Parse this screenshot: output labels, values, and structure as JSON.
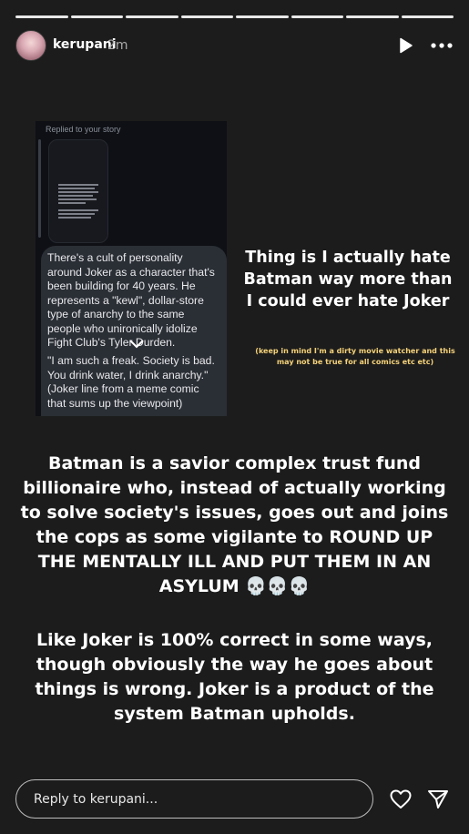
{
  "story": {
    "segments_total": 8,
    "current_segment": 8,
    "username": "kerupani",
    "time_ago": "2m"
  },
  "icons": {
    "avatar": "avatar-photo",
    "play": "play-icon",
    "more": "more-icon",
    "chevron": "chevron-down-icon",
    "heart": "heart-icon",
    "send": "send-icon",
    "skull": "skull-emoji"
  },
  "screenshot": {
    "replied_label": "Replied to your story",
    "message_part1": "There's a cult of personality around Joker as a character that's been building for 40 years. He represents a \"kewl\", dollar-store type of anarchy to the same people who unironically idolize Fight Club's Tyler Durden.",
    "message_part2": "\"I am such a freak. Society is bad. You drink water, I drink anarchy.\" (Joker line from a meme comic that sums up the viewpoint)"
  },
  "text": {
    "heading": "Thing is I actually hate Batman way more than I could ever hate Joker",
    "note": "(keep in mind I'm a dirty movie watcher and this may not be true for all comics etc etc)",
    "paragraph1": "Batman is a savior complex trust fund billionaire who, instead of actually working to solve society's issues, goes out and joins the cops as some vigilante to ROUND UP THE MENTALLY ILL AND PUT THEM IN AN ASYLUM 💀💀💀",
    "paragraph2": "Like Joker is 100% correct in some ways, though obviously the way he goes about things is wrong. Joker is a product of the system Batman upholds."
  },
  "reply": {
    "placeholder": "Reply to kerupani..."
  },
  "colors": {
    "background": "#1c1c1c",
    "note_text": "#f5d27a",
    "bubble": "#2a2e35"
  }
}
